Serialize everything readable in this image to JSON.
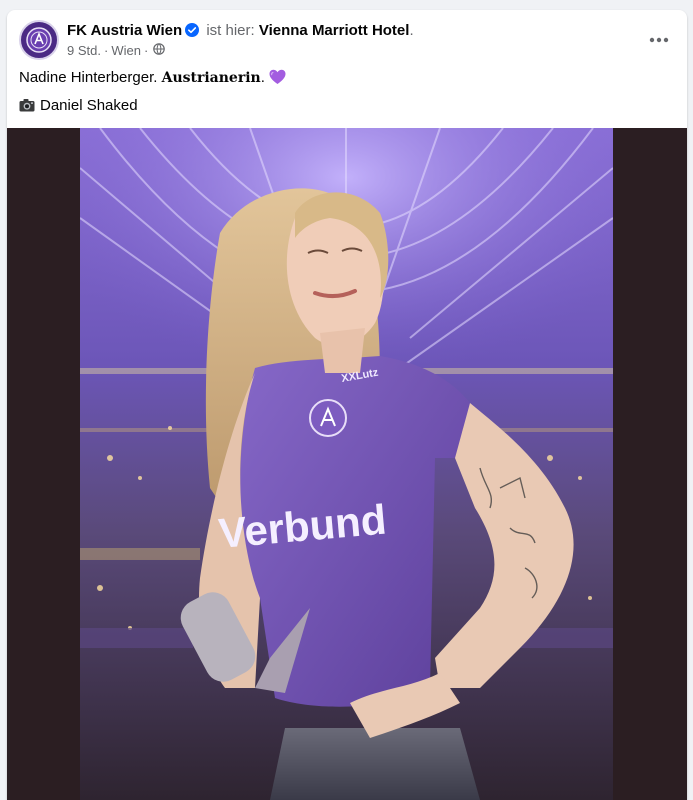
{
  "post": {
    "page_name": "FK Austria Wien",
    "checkin_text": "ist hier:",
    "location": "Vienna Marriott Hotel",
    "location_suffix": ".",
    "time": "9 Std.",
    "place": "Wien",
    "separator": "·",
    "text_name": "Nadine Hinterberger.",
    "text_bold": "Austrianerin",
    "text_after_bold": ".",
    "photo_credit": "Daniel Shaked",
    "icons": {
      "avatar": "austria-wien-crest-icon",
      "verified": "verified-badge-icon",
      "privacy": "globe-icon",
      "more": "more-options-icon",
      "heart": "purple-heart-icon",
      "camera": "camera-icon"
    },
    "colors": {
      "brand_purple": "#4b2a84",
      "verified_blue": "#0866ff",
      "heart_purple": "#a35de0",
      "photo_background": "#2b1e22"
    }
  },
  "photo": {
    "jersey_sponsor": "Verbund",
    "jersey_badge": "XXLutz"
  }
}
